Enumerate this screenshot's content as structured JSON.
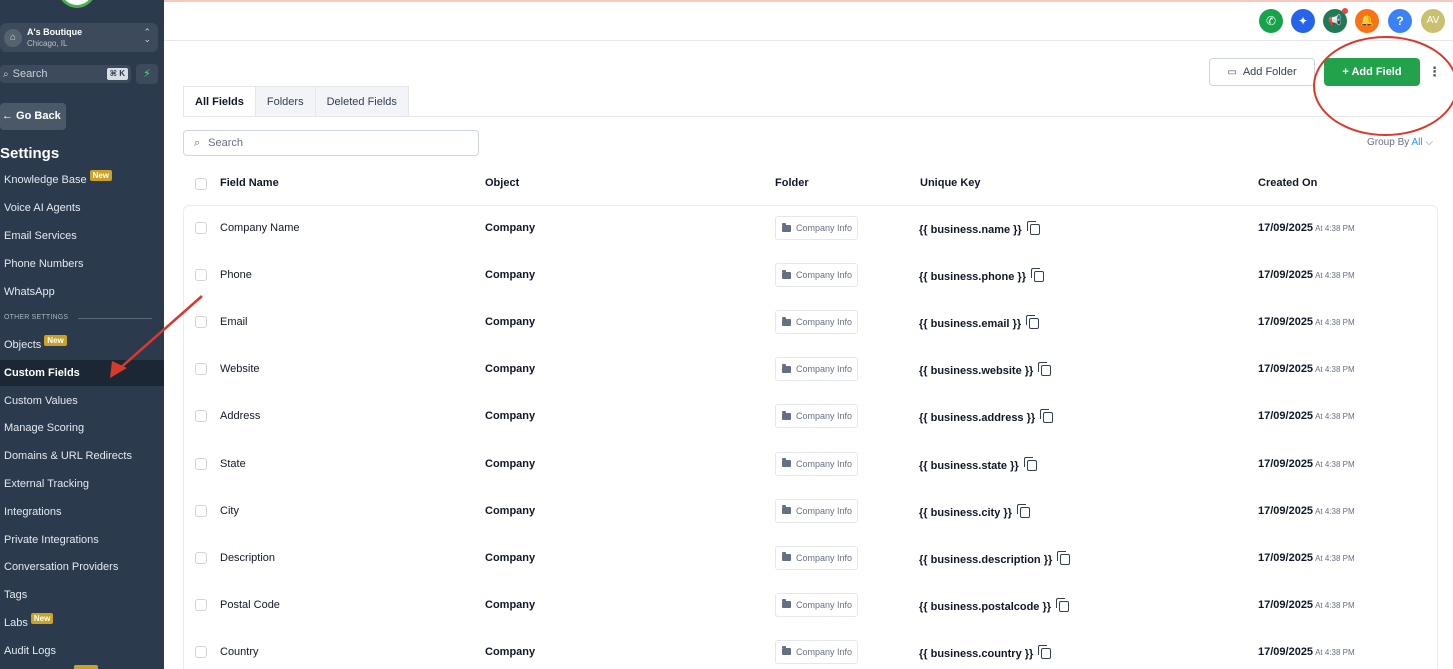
{
  "location": {
    "name": "A's Boutique",
    "city": "Chicago, IL"
  },
  "sidebar_search": {
    "placeholder": "Search",
    "shortcut": "⌘ K"
  },
  "go_back_label": "← Go Back",
  "settings_title": "Settings",
  "nav": {
    "items": [
      {
        "label": "Knowledge Base",
        "badge": "New"
      },
      {
        "label": "Voice AI Agents"
      },
      {
        "label": "Email Services"
      },
      {
        "label": "Phone Numbers"
      },
      {
        "label": "WhatsApp"
      }
    ],
    "section_label": "OTHER SETTINGS",
    "other_items": [
      {
        "label": "Objects",
        "badge": "New"
      },
      {
        "label": "Custom Fields",
        "active": true
      },
      {
        "label": "Custom Values"
      },
      {
        "label": "Manage Scoring"
      },
      {
        "label": "Domains & URL Redirects"
      },
      {
        "label": "External Tracking"
      },
      {
        "label": "Integrations"
      },
      {
        "label": "Private Integrations"
      },
      {
        "label": "Conversation Providers"
      },
      {
        "label": "Tags"
      },
      {
        "label": "Labs",
        "badge": "New"
      },
      {
        "label": "Audit Logs"
      }
    ]
  },
  "topbar": {
    "icons": [
      {
        "name": "phone-icon",
        "glyph": "✆",
        "color": "#16a34a"
      },
      {
        "name": "sparkle-icon",
        "glyph": "✦",
        "color": "#2563eb"
      },
      {
        "name": "megaphone-icon",
        "glyph": "📢",
        "color": "#1f7a55"
      },
      {
        "name": "bell-icon",
        "glyph": "🔔",
        "color": "#f97316"
      },
      {
        "name": "help-icon",
        "glyph": "?",
        "color": "#3b82f6"
      }
    ],
    "avatar_initials": "AV",
    "avatar_color": "#c9c070"
  },
  "actions": {
    "add_folder": "Add Folder",
    "add_field": "+ Add Field"
  },
  "tabs": [
    "All Fields",
    "Folders",
    "Deleted Fields"
  ],
  "table_search_placeholder": "Search",
  "group_by": {
    "label": "Group By",
    "value": "All"
  },
  "table": {
    "headers": {
      "field_name": "Field Name",
      "object": "Object",
      "folder": "Folder",
      "unique_key": "Unique Key",
      "created_on": "Created On"
    },
    "rows": [
      {
        "name": "Company Name",
        "object": "Company",
        "folder": "Company Info",
        "key": "{{ business.name }}",
        "date": "17/09/2025",
        "time": "At 4:38 PM"
      },
      {
        "name": "Phone",
        "object": "Company",
        "folder": "Company Info",
        "key": "{{ business.phone }}",
        "date": "17/09/2025",
        "time": "At 4:38 PM"
      },
      {
        "name": "Email",
        "object": "Company",
        "folder": "Company Info",
        "key": "{{ business.email }}",
        "date": "17/09/2025",
        "time": "At 4:38 PM"
      },
      {
        "name": "Website",
        "object": "Company",
        "folder": "Company Info",
        "key": "{{ business.website }}",
        "date": "17/09/2025",
        "time": "At 4:38 PM"
      },
      {
        "name": "Address",
        "object": "Company",
        "folder": "Company Info",
        "key": "{{ business.address }}",
        "date": "17/09/2025",
        "time": "At 4:38 PM"
      },
      {
        "name": "State",
        "object": "Company",
        "folder": "Company Info",
        "key": "{{ business.state }}",
        "date": "17/09/2025",
        "time": "At 4:38 PM"
      },
      {
        "name": "City",
        "object": "Company",
        "folder": "Company Info",
        "key": "{{ business.city }}",
        "date": "17/09/2025",
        "time": "At 4:38 PM"
      },
      {
        "name": "Description",
        "object": "Company",
        "folder": "Company Info",
        "key": "{{ business.description }}",
        "date": "17/09/2025",
        "time": "At 4:38 PM"
      },
      {
        "name": "Postal Code",
        "object": "Company",
        "folder": "Company Info",
        "key": "{{ business.postalcode }}",
        "date": "17/09/2025",
        "time": "At 4:38 PM"
      },
      {
        "name": "Country",
        "object": "Company",
        "folder": "Company Info",
        "key": "{{ business.country }}",
        "date": "17/09/2025",
        "time": "At 4:38 PM"
      }
    ]
  },
  "annotation_color": "#d9392b"
}
